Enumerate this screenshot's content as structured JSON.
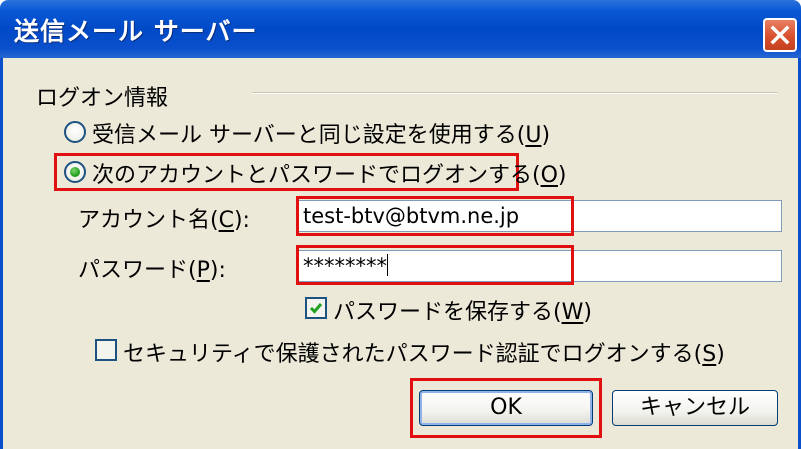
{
  "dialog": {
    "title": "送信メール サーバー",
    "close_icon": "close-icon",
    "accent_color": "#0a4fcc",
    "highlight_color": "#e01010"
  },
  "logon_group": {
    "label": "ログオン情報"
  },
  "radio_same": {
    "label": "受信メール サーバーと同じ設定を使用する(",
    "mnemonic": "U",
    "suffix": ")",
    "selected": false
  },
  "radio_account": {
    "label": "次のアカウントとパスワードでログオンする(",
    "mnemonic": "O",
    "suffix": ")",
    "selected": true
  },
  "account": {
    "label": "アカウント名(",
    "mnemonic": "C",
    "suffix": "):",
    "value": "test-btv@btvm.ne.jp"
  },
  "password": {
    "label": "パスワード(",
    "mnemonic": "P",
    "suffix": "):",
    "value": "********"
  },
  "save_password": {
    "label": "パスワードを保存する(",
    "mnemonic": "W",
    "suffix": ")",
    "checked": true
  },
  "spa": {
    "label": "セキュリティで保護されたパスワード認証でログオンする(",
    "mnemonic": "S",
    "suffix": ")",
    "checked": false
  },
  "buttons": {
    "ok": "OK",
    "cancel": "キャンセル"
  }
}
